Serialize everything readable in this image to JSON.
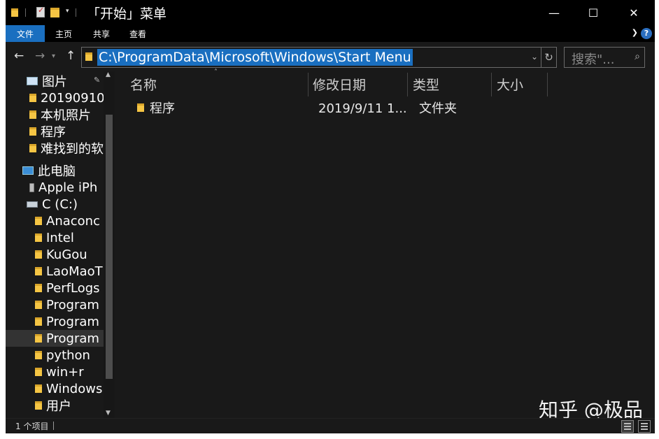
{
  "window": {
    "title": "「开始」菜单",
    "controls": {
      "minimize": "—",
      "maximize": "☐",
      "close": "✕"
    }
  },
  "ribbon": {
    "tabs": [
      "文件",
      "主页",
      "共享",
      "查看"
    ],
    "help": "?"
  },
  "address": {
    "path": "C:\\ProgramData\\Microsoft\\Windows\\Start Menu",
    "search_placeholder": "搜索\"..."
  },
  "nav": {
    "quick_access": [
      {
        "label": "图片",
        "icon": "pictures-icon",
        "pinned": true
      },
      {
        "label": "20190910",
        "icon": "folder-icon"
      },
      {
        "label": "本机照片",
        "icon": "folder-icon"
      },
      {
        "label": "程序",
        "icon": "folder-icon"
      },
      {
        "label": "难找到的软",
        "icon": "folder-icon"
      }
    ],
    "this_pc": {
      "label": "此电脑",
      "icon": "computer-icon"
    },
    "device": {
      "label": "Apple iPh",
      "icon": "phone-icon"
    },
    "drive": {
      "label": "C (C:)",
      "icon": "drive-icon"
    },
    "drive_folders": [
      "Anaconc",
      "Intel",
      "KuGou",
      "LaoMaoT",
      "PerfLogs",
      "Program",
      "Program",
      "Program",
      "python",
      "win+r",
      "Windows",
      "用户"
    ],
    "selected_index": 7
  },
  "columns": {
    "name": "名称",
    "date": "修改日期",
    "type": "类型",
    "size": "大小"
  },
  "files": [
    {
      "name": "程序",
      "date": "2019/9/11 1...",
      "type": "文件夹",
      "size": ""
    }
  ],
  "status": {
    "count": "1 个项目"
  },
  "watermark": "知乎 @极品"
}
